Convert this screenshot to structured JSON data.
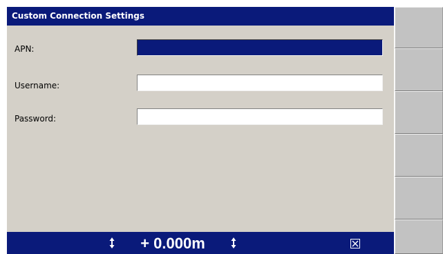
{
  "window": {
    "title": "Custom Connection Settings"
  },
  "form": {
    "apn": {
      "label": "APN:",
      "value": ""
    },
    "username": {
      "label": "Username:",
      "value": ""
    },
    "password": {
      "label": "Password:",
      "value": ""
    }
  },
  "status_bar": {
    "offset_value": "+ 0.000m",
    "icons": [
      "up-down-arrow-icon",
      "up-down-arrow-icon",
      "close-box-icon"
    ]
  },
  "softkeys": [
    {
      "label": ""
    },
    {
      "label": ""
    },
    {
      "label": ""
    },
    {
      "label": ""
    },
    {
      "label": ""
    },
    {
      "label": ""
    }
  ],
  "colors": {
    "title_bar": "#0a1a7a",
    "panel_background": "#d4d0c8",
    "softkey_background": "#c2c2c2",
    "field_background": "#ffffff",
    "selected_field": "#0a1a7a"
  }
}
